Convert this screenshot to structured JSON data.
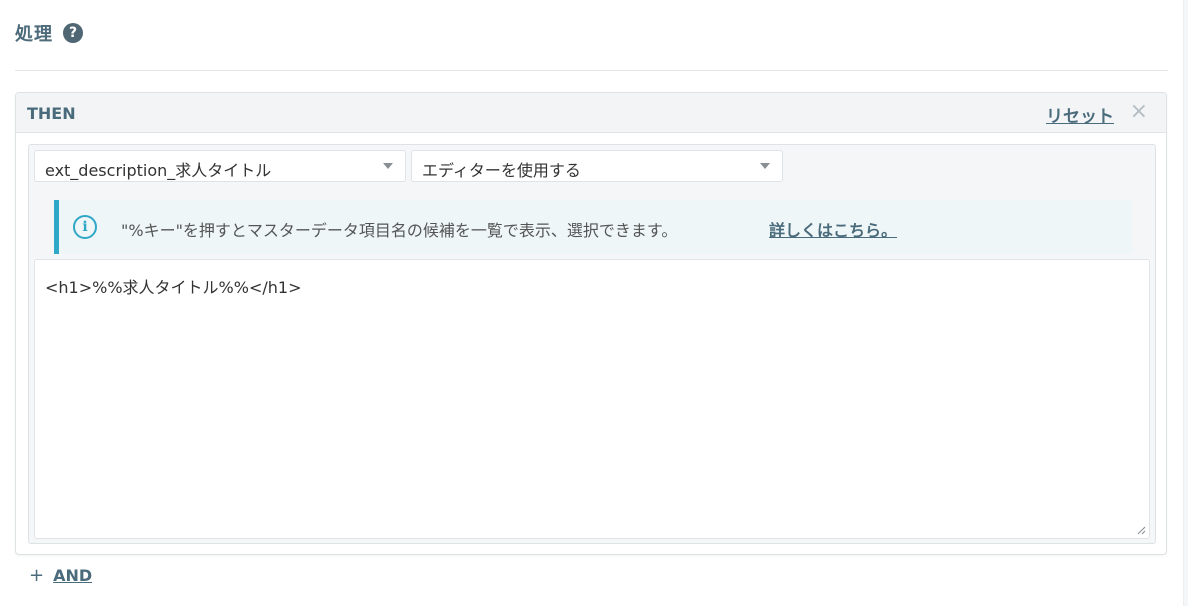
{
  "section": {
    "title": "処理",
    "help_glyph": "?"
  },
  "then_block": {
    "label": "THEN",
    "reset_label": "リセット",
    "close_glyph": "×"
  },
  "selects": {
    "field_value": "ext_description_求人タイトル",
    "mode_value": "エディターを使用する"
  },
  "info": {
    "icon_glyph": "i",
    "message": "\"%キー\"を押すとマスターデータ項目名の候補を一覧で表示、選択できます。",
    "link_text": "詳しくはこちら。"
  },
  "editor": {
    "content": "<h1>%%求人タイトル%%</h1>"
  },
  "and_row": {
    "plus_glyph": "+",
    "label": "AND"
  },
  "colors": {
    "accent": "#4a6b7b",
    "info_border": "#2fa7c6",
    "info_bg": "#eef6f8"
  }
}
